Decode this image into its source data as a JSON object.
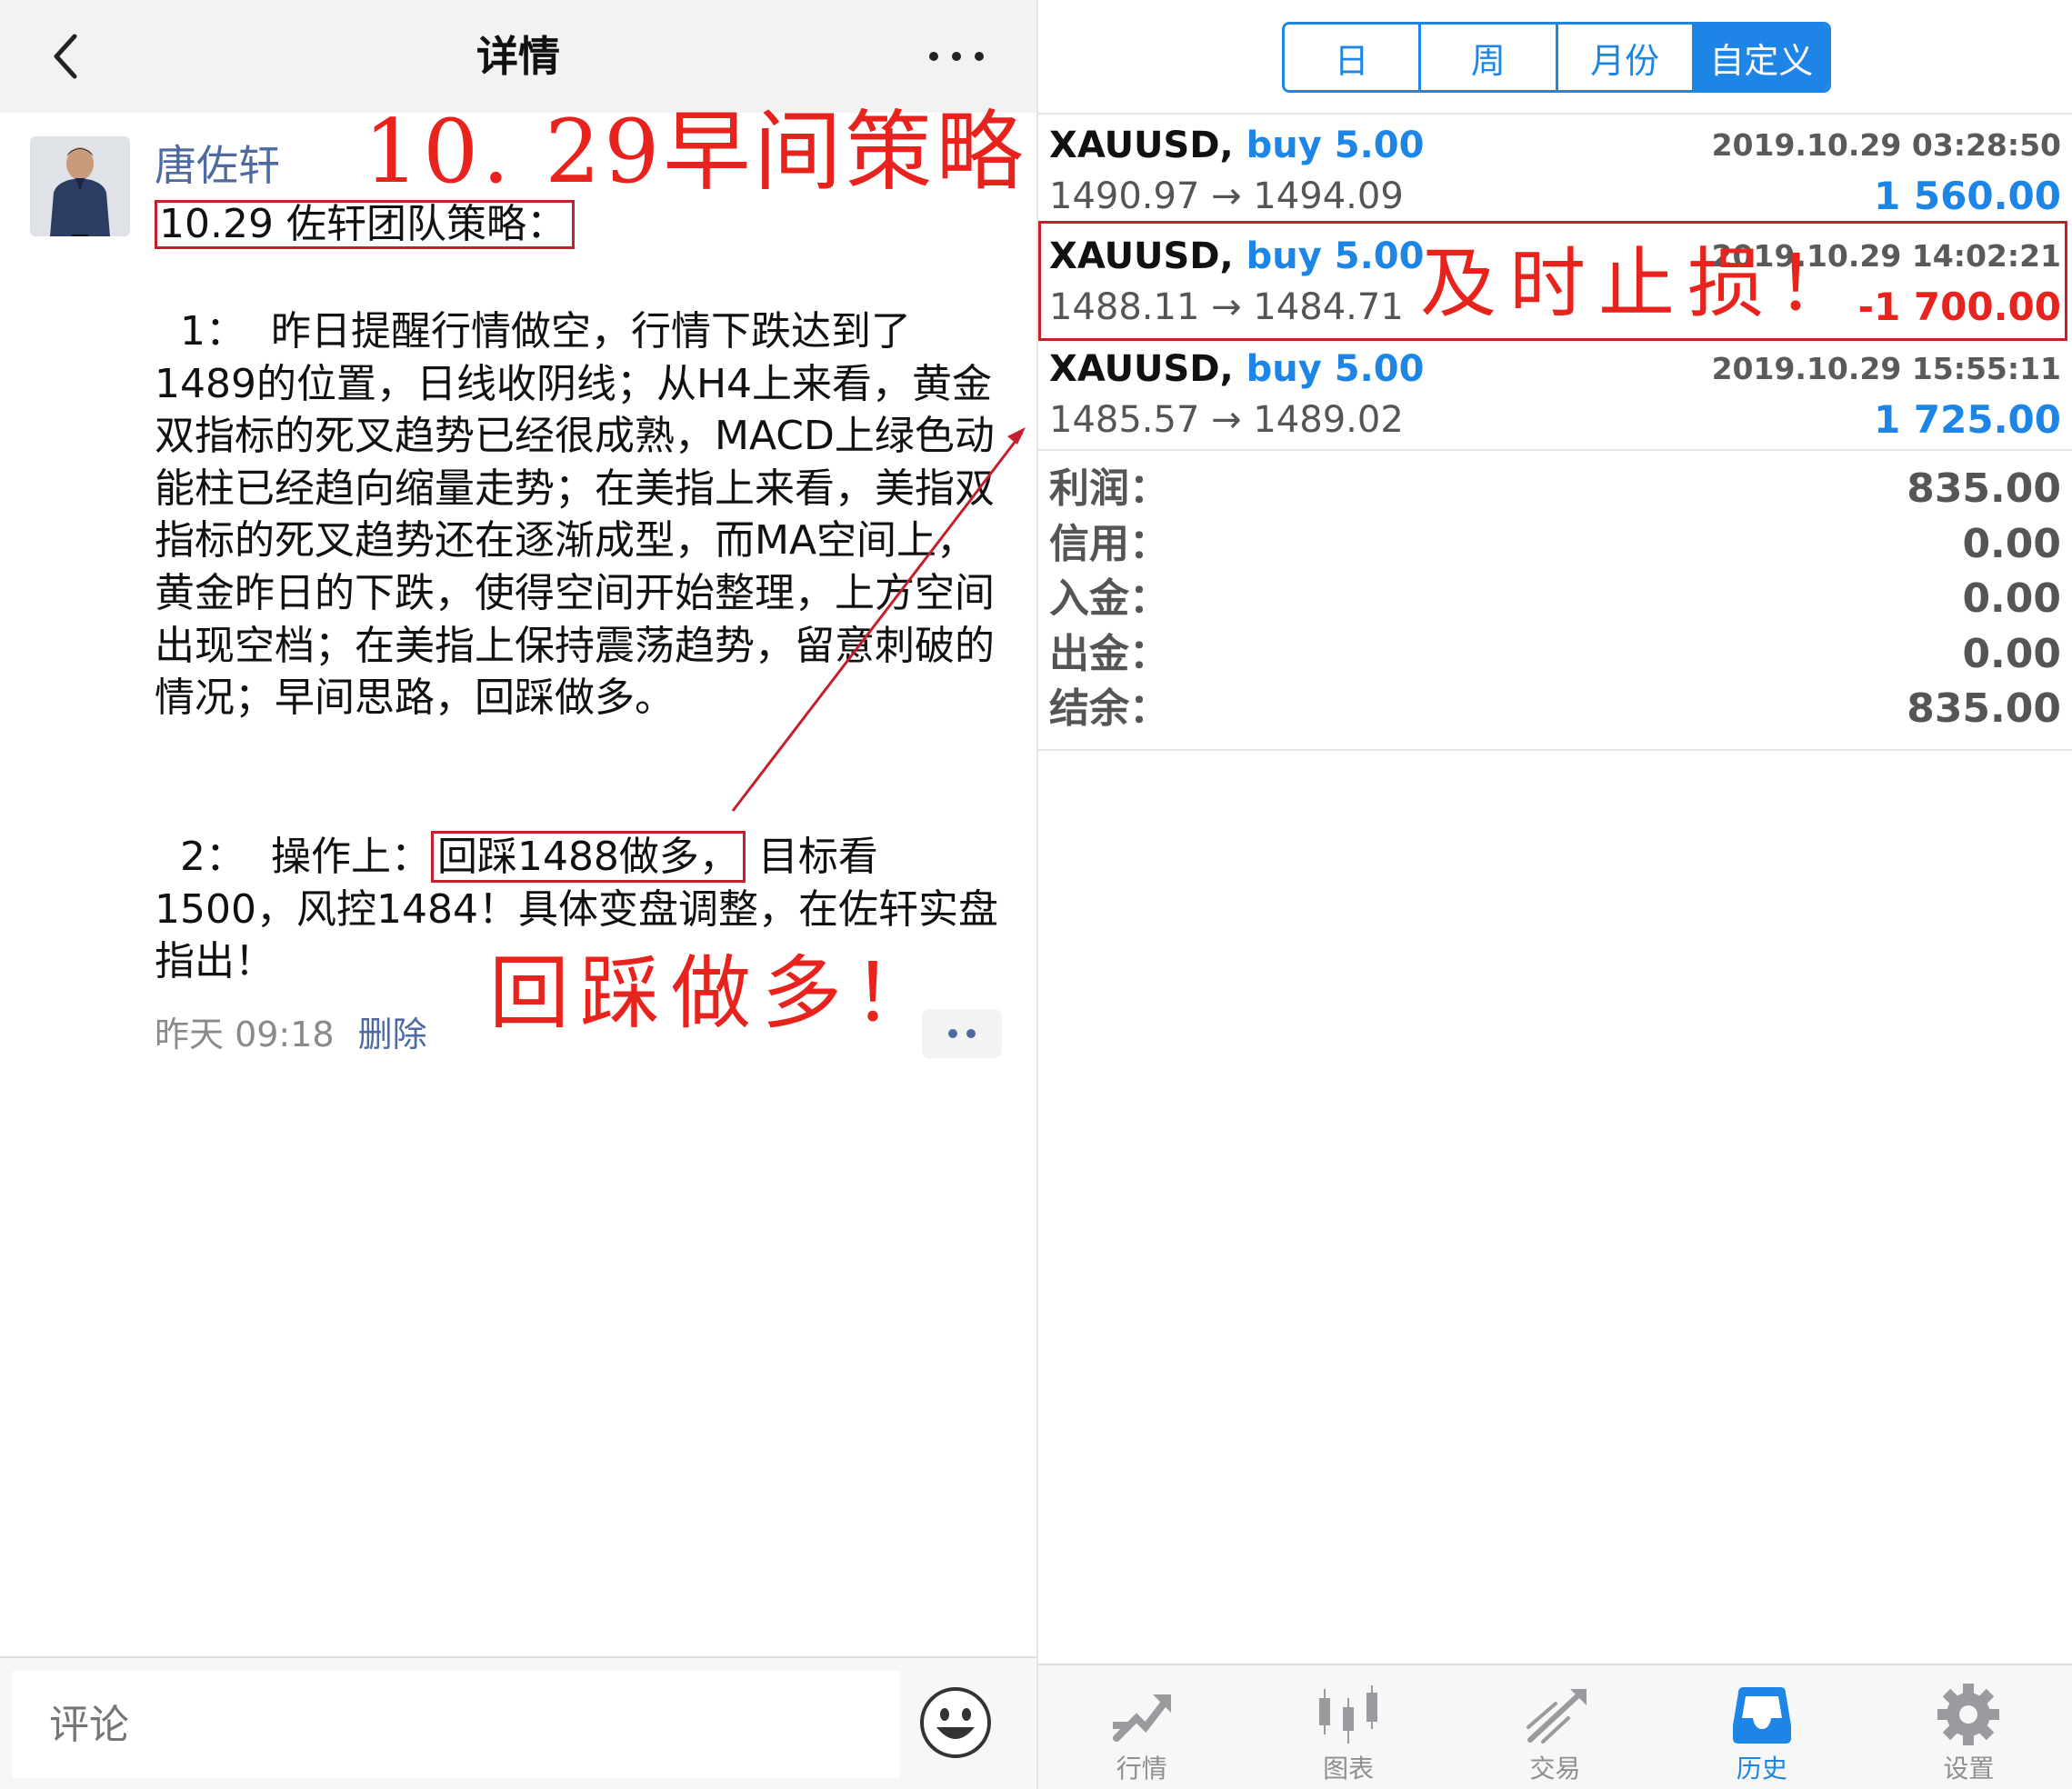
{
  "left": {
    "nav": {
      "title": "详情",
      "back_icon": "chevron-left-icon",
      "more_icon": "ellipsis-icon"
    },
    "post": {
      "author": "唐佐轩",
      "title": "10.29 佐轩团队策略：",
      "para1": "  1：  昨日提醒行情做空，行情下跌达到了1489的位置，日线收阴线；从H4上来看，黄金双指标的死叉趋势已经很成熟，MACD上绿色动能柱已经趋向缩量走势；在美指上来看，美指双指标的死叉趋势还在逐渐成型，而MA空间上，黄金昨日的下跌，使得空间开始整理，上方空间出现空档；在美指上保持震荡趋势，留意刺破的情况；早间思路，回踩做多。",
      "para2_prefix": "  2：  操作上：",
      "para2_boxed": "回踩1488做多，",
      "para2_suffix": " 目标看1500，风控1484！具体变盘调整，在佐轩实盘指出！",
      "time": "昨天 09:18",
      "delete_label": "删除"
    },
    "annotations": {
      "headline": "10. 29早间策略！",
      "buy_note": "回踩做多！"
    },
    "comment": {
      "placeholder": "评论",
      "emoji_icon": "smiley-icon"
    }
  },
  "right": {
    "period_tabs": [
      {
        "label": "日",
        "active": false
      },
      {
        "label": "周",
        "active": false
      },
      {
        "label": "月份",
        "active": false
      },
      {
        "label": "自定义",
        "active": true
      }
    ],
    "deals": [
      {
        "symbol": "XAUUSD,",
        "direction": "buy 5.00",
        "time": "2019.10.29 03:28:50",
        "prices": "1490.97 → 1494.09",
        "profit": "1 560.00",
        "profit_color": "#1d85e6"
      },
      {
        "symbol": "XAUUSD,",
        "direction": "buy 5.00",
        "time": "2019.10.29 14:02:21",
        "prices": "1488.11 → 1484.71",
        "profit": "-1 700.00",
        "profit_color": "#e8231d"
      },
      {
        "symbol": "XAUUSD,",
        "direction": "buy 5.00",
        "time": "2019.10.29 15:55:11",
        "prices": "1485.57 → 1489.02",
        "profit": "1 725.00",
        "profit_color": "#1d85e6"
      }
    ],
    "annotation": {
      "stop_note": "及时止损！"
    },
    "summary": [
      {
        "label": "利润：",
        "value": "835.00"
      },
      {
        "label": "信用：",
        "value": "0.00"
      },
      {
        "label": "入金：",
        "value": "0.00"
      },
      {
        "label": "出金：",
        "value": "0.00"
      },
      {
        "label": "结余：",
        "value": "835.00"
      }
    ],
    "tabbar": [
      {
        "label": "行情",
        "icon": "quotes-icon",
        "active": false
      },
      {
        "label": "图表",
        "icon": "chart-icon",
        "active": false
      },
      {
        "label": "交易",
        "icon": "trade-icon",
        "active": false
      },
      {
        "label": "历史",
        "icon": "history-icon",
        "active": true
      },
      {
        "label": "设置",
        "icon": "settings-icon",
        "active": false
      }
    ]
  },
  "colors": {
    "accent_blue": "#1d85e6",
    "annotation_red": "#e8231d",
    "link_blue": "#4e6aa0"
  }
}
